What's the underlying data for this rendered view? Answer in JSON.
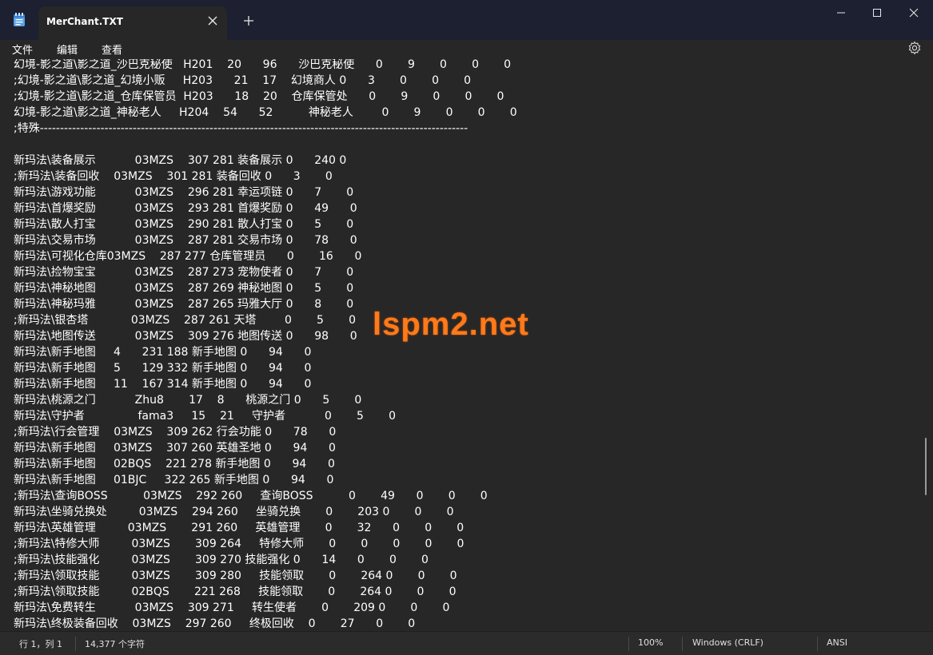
{
  "window": {
    "tab_title": "MerChant.TXT",
    "icons": {
      "app": "notepad-icon",
      "close_tab": "close-icon",
      "new_tab": "plus-icon",
      "minimize": "minimize-icon",
      "maximize": "maximize-icon",
      "close": "close-icon"
    }
  },
  "menu": {
    "file": "文件",
    "edit": "编辑",
    "view": "查看",
    "settings_icon": "gear-icon"
  },
  "editor": {
    "lines": [
      "幻境-影之道\\影之道_沙巴克秘使   H201    20      96      沙巴克秘使      0       9       0       0       0",
      ";幻境-影之道\\影之道_幻境小贩     H203      21    17    幻境商人 0      3       0       0       0",
      ";幻境-影之道\\影之道_仓库保管员  H203      18    20    仓库保管处      0       9       0       0       0",
      "幻境-影之道\\影之道_神秘老人     H204    54      52          神秘老人        0       9       0       0       0",
      ";特殊----------------------------------------------------------------------------------------------------------",
      "",
      "新玛法\\装备展示           03MZS    307 281 装备展示 0      240 0",
      ";新玛法\\装备回收    03MZS    301 281 装备回收 0      3       0",
      "新玛法\\游戏功能           03MZS    296 281 幸运项链 0      7       0",
      "新玛法\\首爆奖励           03MZS    293 281 首爆奖励 0      49      0",
      "新玛法\\散人打宝           03MZS    290 281 散人打宝 0      5       0",
      "新玛法\\交易市场           03MZS    287 281 交易市场 0      78      0",
      "新玛法\\可视化仓库03MZS    287 277 仓库管理员      0       16      0",
      "新玛法\\捡物宝宝           03MZS    287 273 宠物使者 0      7       0",
      "新玛法\\神秘地图           03MZS    287 269 神秘地图 0      5       0",
      "新玛法\\神秘玛雅           03MZS    287 265 玛雅大厅 0      8       0",
      ";新玛法\\银杏塔            03MZS    287 261 天塔        0       5       0",
      "新玛法\\地图传送           03MZS    309 276 地图传送 0      98      0",
      "新玛法\\新手地图     4      231 188 新手地图 0      94      0",
      "新玛法\\新手地图     5      129 332 新手地图 0      94      0",
      "新玛法\\新手地图     11    167 314 新手地图 0      94      0",
      "新玛法\\桃源之门           Zhu8       17    8      桃源之门 0      5       0",
      "新玛法\\守护者               fama3     15    21     守护者           0       5       0",
      ";新玛法\\行会管理    03MZS    309 262 行会功能 0      78      0",
      "新玛法\\新手地图     03MZS    307 260 英雄圣地 0      94      0",
      "新玛法\\新手地图     02BQS    221 278 新手地图 0      94      0",
      "新玛法\\新手地图     01BJC     322 265 新手地图 0      94      0",
      ";新玛法\\查询BOSS          03MZS    292 260     查询BOSS          0       49      0       0       0",
      "新玛法\\坐骑兑换处         03MZS    294 260     坐骑兑换       0       203 0       0       0",
      "新玛法\\英雄管理         03MZS       291 260     英雄管理       0       32      0       0       0",
      ";新玛法\\特修大师         03MZS       309 264     特修大师       0       0       0       0       0",
      ";新玛法\\技能强化         03MZS       309 270 技能强化 0      14      0       0       0",
      ";新玛法\\领取技能         03MZS       309 280     技能领取       0       264 0       0       0",
      ";新玛法\\领取技能         02BQS       221 268     技能领取       0       264 0       0       0",
      "新玛法\\免费转生           03MZS    309 271     转生使者       0       209 0       0       0",
      "新玛法\\终极装备回收    03MZS    297 260     终极回收    0       27      0       0"
    ]
  },
  "watermark": "lspm2.net",
  "status": {
    "position": "行 1，列 1",
    "char_count": "14,377 个字符",
    "zoom": "100%",
    "line_ending": "Windows (CRLF)",
    "encoding": "ANSI"
  }
}
